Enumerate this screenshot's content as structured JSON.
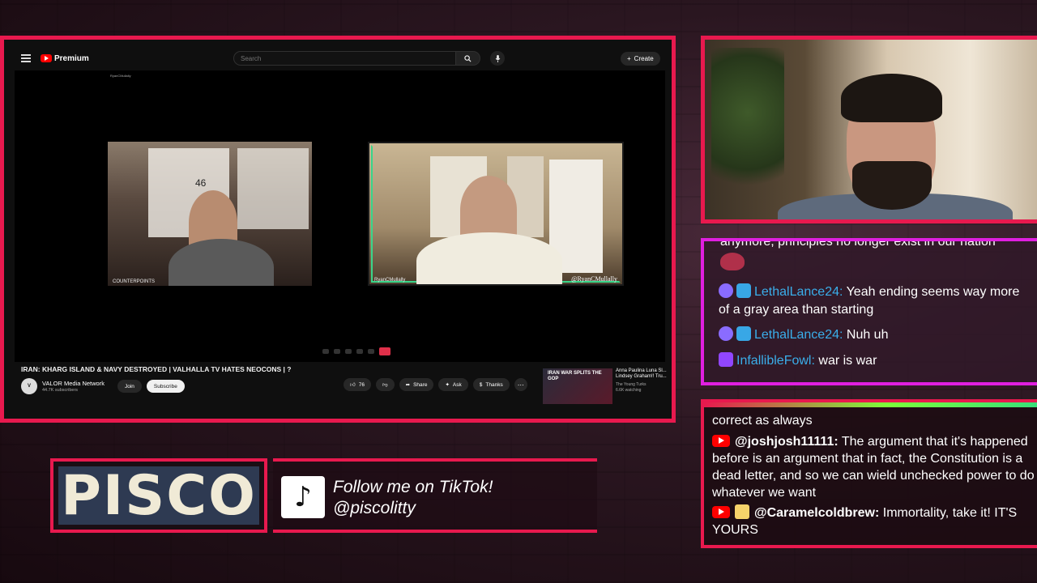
{
  "youtube": {
    "brand": "Premium",
    "search_placeholder": "Search",
    "create_label": "Create",
    "video": {
      "channel_tag": "RyanCMullally",
      "cam_left_label": "COUNTERPOINTS",
      "cam_right_label": "RyanCMullally",
      "cam_right_handle": "@RyanCMullally",
      "shelf_number": "46"
    },
    "title": "IRAN: KHARG ISLAND & NAVY DESTROYED | VALHALLA TV HATES NEOCONS | ?",
    "channel_name": "VALOR Media Network",
    "subscribers": "44.7K subscribers",
    "join_label": "Join",
    "subscribe_label": "Subscribe",
    "like_count": "76",
    "share_label": "Share",
    "ask_label": "Ask",
    "thanks_label": "Thanks",
    "recommended": {
      "thumb_text": "IRAN WAR SPLITS THE GOP",
      "title": "Anna Paulina Luna Sl... Lindsey Graham!! Tru...",
      "channel": "The Young Turks",
      "watching": "6.6K watching"
    }
  },
  "chat_top": {
    "cut_line": "anymore, principles no longer exist in our nation",
    "messages": [
      {
        "user": "LethalLance24:",
        "text": " Yeah ending seems way more of a gray area than starting"
      },
      {
        "user": "LethalLance24:",
        "text": " Nuh uh"
      },
      {
        "user": "InfallibleFowl:",
        "text": " war is war"
      }
    ]
  },
  "chat_bottom": {
    "cut_line": "correct as always",
    "messages": [
      {
        "user": "@joshjosh11111:",
        "text": " The argument that it's happened before is an argument that in fact, the Constitution is a dead letter, and so we can wield unchecked power to do whatever we want"
      },
      {
        "user": "@Caramelcoldbrew:",
        "text": " Immortality, take it! IT'S YOURS"
      }
    ]
  },
  "nameplate": {
    "name": "PISCO"
  },
  "tiktok": {
    "line1": "Follow me on TikTok!",
    "line2": "@piscolitty"
  },
  "colors": {
    "accent": "#e8194e",
    "chat_accent": "#e01fe0",
    "username_blue": "#3aaeea"
  }
}
